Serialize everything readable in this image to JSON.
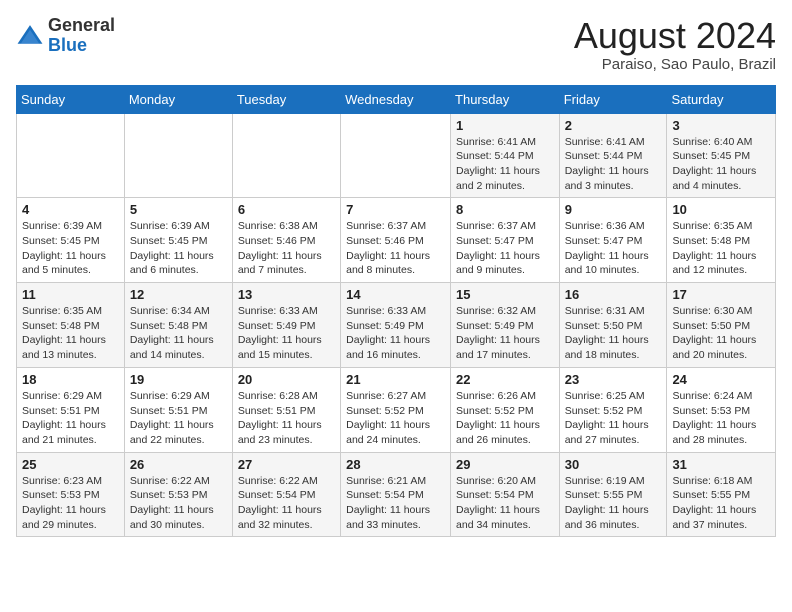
{
  "header": {
    "logo_general": "General",
    "logo_blue": "Blue",
    "month_year": "August 2024",
    "location": "Paraiso, Sao Paulo, Brazil"
  },
  "weekdays": [
    "Sunday",
    "Monday",
    "Tuesday",
    "Wednesday",
    "Thursday",
    "Friday",
    "Saturday"
  ],
  "weeks": [
    [
      {
        "day": "",
        "detail": ""
      },
      {
        "day": "",
        "detail": ""
      },
      {
        "day": "",
        "detail": ""
      },
      {
        "day": "",
        "detail": ""
      },
      {
        "day": "1",
        "detail": "Sunrise: 6:41 AM\nSunset: 5:44 PM\nDaylight: 11 hours and 2 minutes."
      },
      {
        "day": "2",
        "detail": "Sunrise: 6:41 AM\nSunset: 5:44 PM\nDaylight: 11 hours and 3 minutes."
      },
      {
        "day": "3",
        "detail": "Sunrise: 6:40 AM\nSunset: 5:45 PM\nDaylight: 11 hours and 4 minutes."
      }
    ],
    [
      {
        "day": "4",
        "detail": "Sunrise: 6:39 AM\nSunset: 5:45 PM\nDaylight: 11 hours and 5 minutes."
      },
      {
        "day": "5",
        "detail": "Sunrise: 6:39 AM\nSunset: 5:45 PM\nDaylight: 11 hours and 6 minutes."
      },
      {
        "day": "6",
        "detail": "Sunrise: 6:38 AM\nSunset: 5:46 PM\nDaylight: 11 hours and 7 minutes."
      },
      {
        "day": "7",
        "detail": "Sunrise: 6:37 AM\nSunset: 5:46 PM\nDaylight: 11 hours and 8 minutes."
      },
      {
        "day": "8",
        "detail": "Sunrise: 6:37 AM\nSunset: 5:47 PM\nDaylight: 11 hours and 9 minutes."
      },
      {
        "day": "9",
        "detail": "Sunrise: 6:36 AM\nSunset: 5:47 PM\nDaylight: 11 hours and 10 minutes."
      },
      {
        "day": "10",
        "detail": "Sunrise: 6:35 AM\nSunset: 5:48 PM\nDaylight: 11 hours and 12 minutes."
      }
    ],
    [
      {
        "day": "11",
        "detail": "Sunrise: 6:35 AM\nSunset: 5:48 PM\nDaylight: 11 hours and 13 minutes."
      },
      {
        "day": "12",
        "detail": "Sunrise: 6:34 AM\nSunset: 5:48 PM\nDaylight: 11 hours and 14 minutes."
      },
      {
        "day": "13",
        "detail": "Sunrise: 6:33 AM\nSunset: 5:49 PM\nDaylight: 11 hours and 15 minutes."
      },
      {
        "day": "14",
        "detail": "Sunrise: 6:33 AM\nSunset: 5:49 PM\nDaylight: 11 hours and 16 minutes."
      },
      {
        "day": "15",
        "detail": "Sunrise: 6:32 AM\nSunset: 5:49 PM\nDaylight: 11 hours and 17 minutes."
      },
      {
        "day": "16",
        "detail": "Sunrise: 6:31 AM\nSunset: 5:50 PM\nDaylight: 11 hours and 18 minutes."
      },
      {
        "day": "17",
        "detail": "Sunrise: 6:30 AM\nSunset: 5:50 PM\nDaylight: 11 hours and 20 minutes."
      }
    ],
    [
      {
        "day": "18",
        "detail": "Sunrise: 6:29 AM\nSunset: 5:51 PM\nDaylight: 11 hours and 21 minutes."
      },
      {
        "day": "19",
        "detail": "Sunrise: 6:29 AM\nSunset: 5:51 PM\nDaylight: 11 hours and 22 minutes."
      },
      {
        "day": "20",
        "detail": "Sunrise: 6:28 AM\nSunset: 5:51 PM\nDaylight: 11 hours and 23 minutes."
      },
      {
        "day": "21",
        "detail": "Sunrise: 6:27 AM\nSunset: 5:52 PM\nDaylight: 11 hours and 24 minutes."
      },
      {
        "day": "22",
        "detail": "Sunrise: 6:26 AM\nSunset: 5:52 PM\nDaylight: 11 hours and 26 minutes."
      },
      {
        "day": "23",
        "detail": "Sunrise: 6:25 AM\nSunset: 5:52 PM\nDaylight: 11 hours and 27 minutes."
      },
      {
        "day": "24",
        "detail": "Sunrise: 6:24 AM\nSunset: 5:53 PM\nDaylight: 11 hours and 28 minutes."
      }
    ],
    [
      {
        "day": "25",
        "detail": "Sunrise: 6:23 AM\nSunset: 5:53 PM\nDaylight: 11 hours and 29 minutes."
      },
      {
        "day": "26",
        "detail": "Sunrise: 6:22 AM\nSunset: 5:53 PM\nDaylight: 11 hours and 30 minutes."
      },
      {
        "day": "27",
        "detail": "Sunrise: 6:22 AM\nSunset: 5:54 PM\nDaylight: 11 hours and 32 minutes."
      },
      {
        "day": "28",
        "detail": "Sunrise: 6:21 AM\nSunset: 5:54 PM\nDaylight: 11 hours and 33 minutes."
      },
      {
        "day": "29",
        "detail": "Sunrise: 6:20 AM\nSunset: 5:54 PM\nDaylight: 11 hours and 34 minutes."
      },
      {
        "day": "30",
        "detail": "Sunrise: 6:19 AM\nSunset: 5:55 PM\nDaylight: 11 hours and 36 minutes."
      },
      {
        "day": "31",
        "detail": "Sunrise: 6:18 AM\nSunset: 5:55 PM\nDaylight: 11 hours and 37 minutes."
      }
    ]
  ]
}
